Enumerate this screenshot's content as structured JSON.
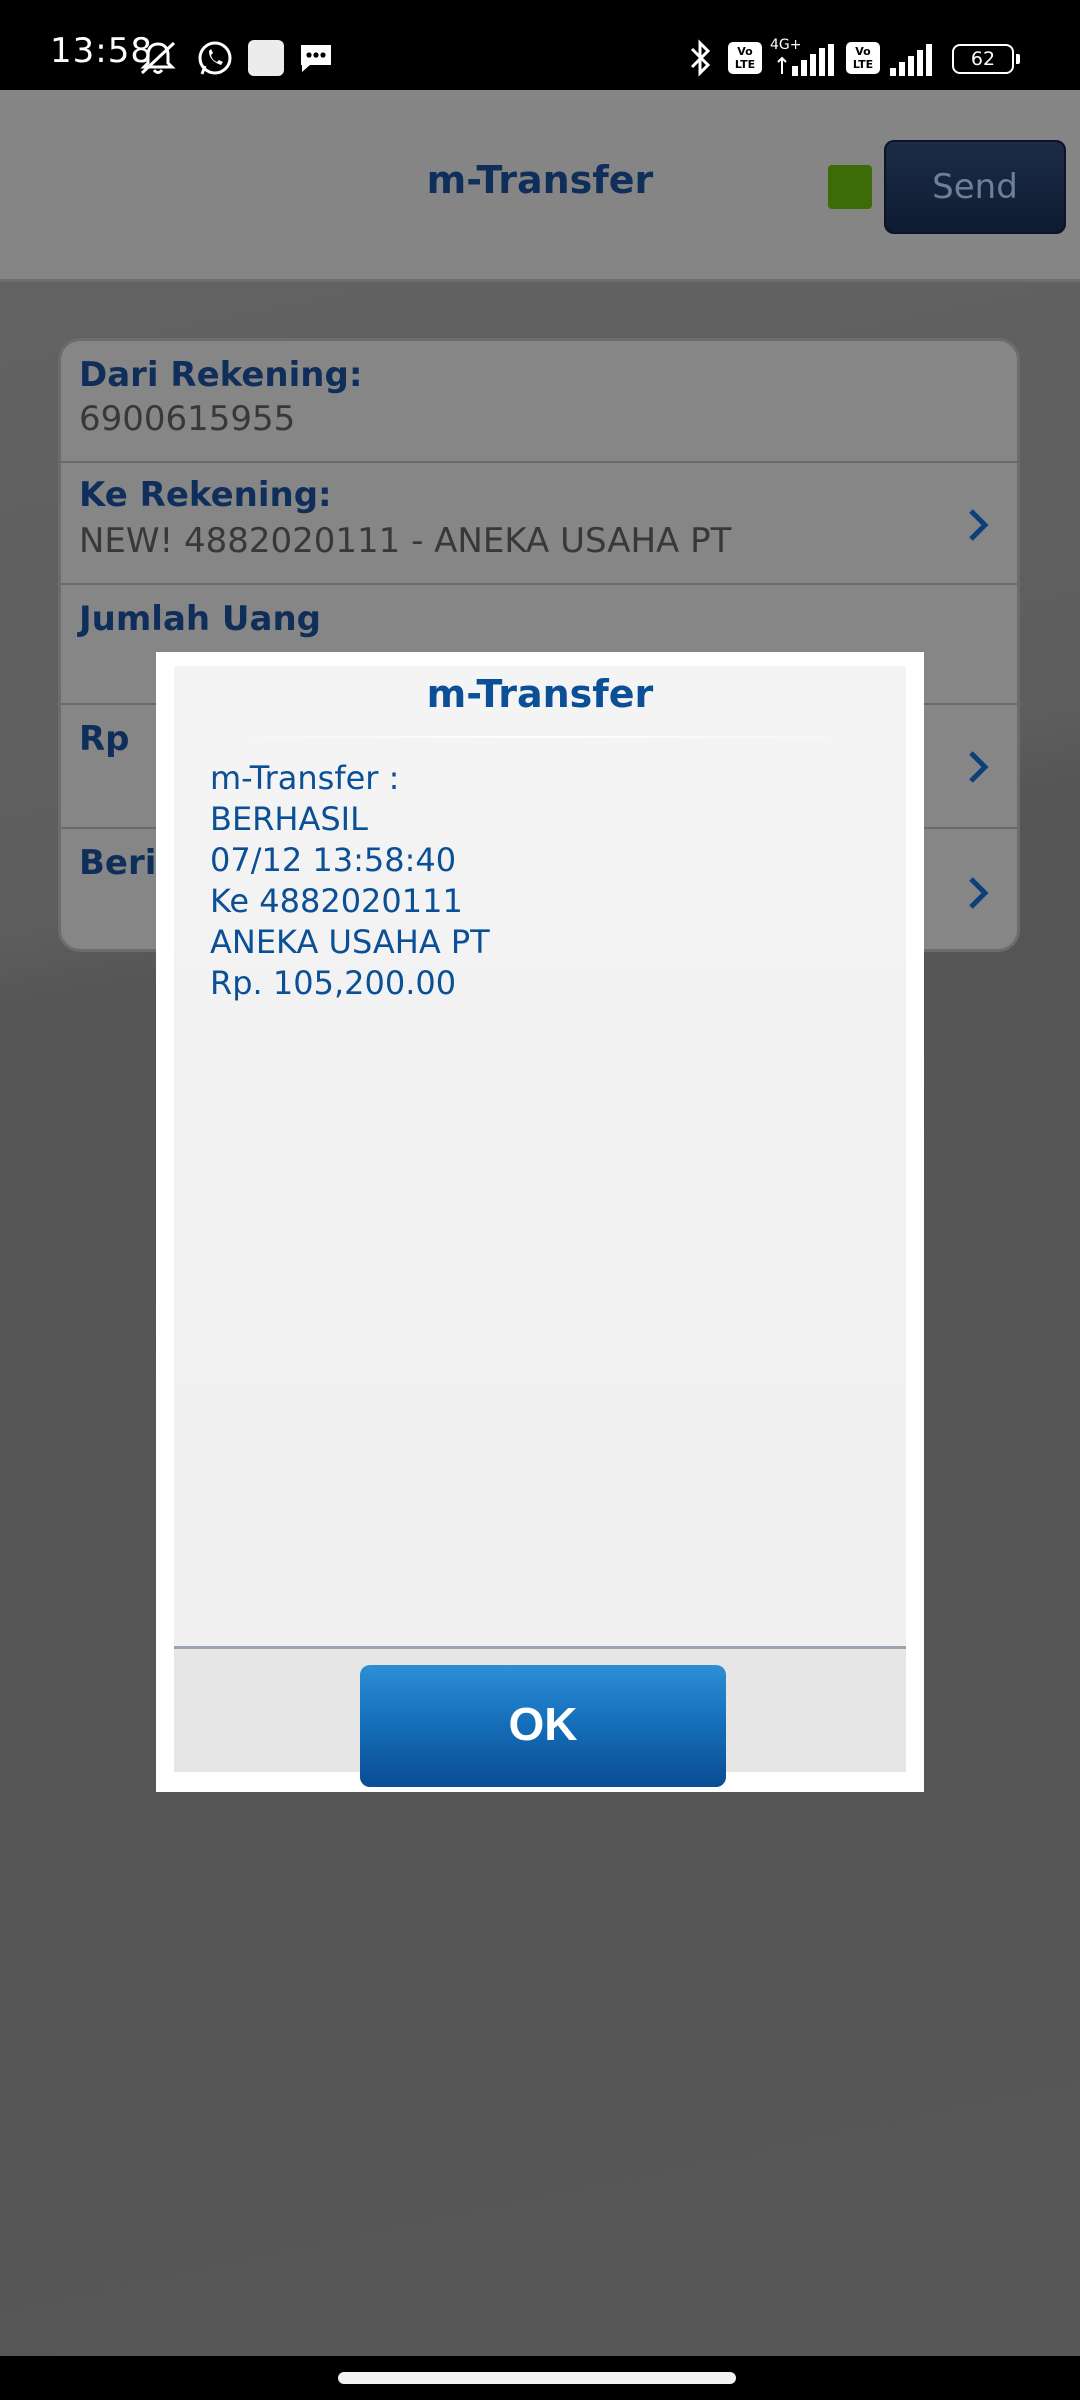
{
  "status_bar": {
    "time": "13:58",
    "network_label": "4G+",
    "volte_label": "Vo\nLTE",
    "battery": "62",
    "icons": [
      "mute-notifications-icon",
      "whatsapp-icon",
      "app-icon",
      "message-icon",
      "bluetooth-icon",
      "volte-icon",
      "signal-icon",
      "battery-icon"
    ]
  },
  "header": {
    "title": "m-Transfer",
    "send_label": "Send",
    "indicator_color": "#3d6b08"
  },
  "form": {
    "dari_label": "Dari Rekening:",
    "dari_value": "6900615955",
    "ke_label": "Ke Rekening:",
    "ke_value": "NEW! 4882020111 - ANEKA USAHA PT",
    "jumlah_label": "Jumlah Uang",
    "rp_label": "Rp",
    "berita_label": "Berita"
  },
  "dialog": {
    "title": "m-Transfer",
    "message_lines": [
      "m-Transfer :",
      "BERHASIL",
      "07/12 13:58:40",
      "Ke 4882020111",
      "ANEKA USAHA PT",
      "Rp. 105,200.00"
    ],
    "ok_label": "OK"
  },
  "colors": {
    "accent": "#0b4f96",
    "ok_button": "#1670bb"
  }
}
